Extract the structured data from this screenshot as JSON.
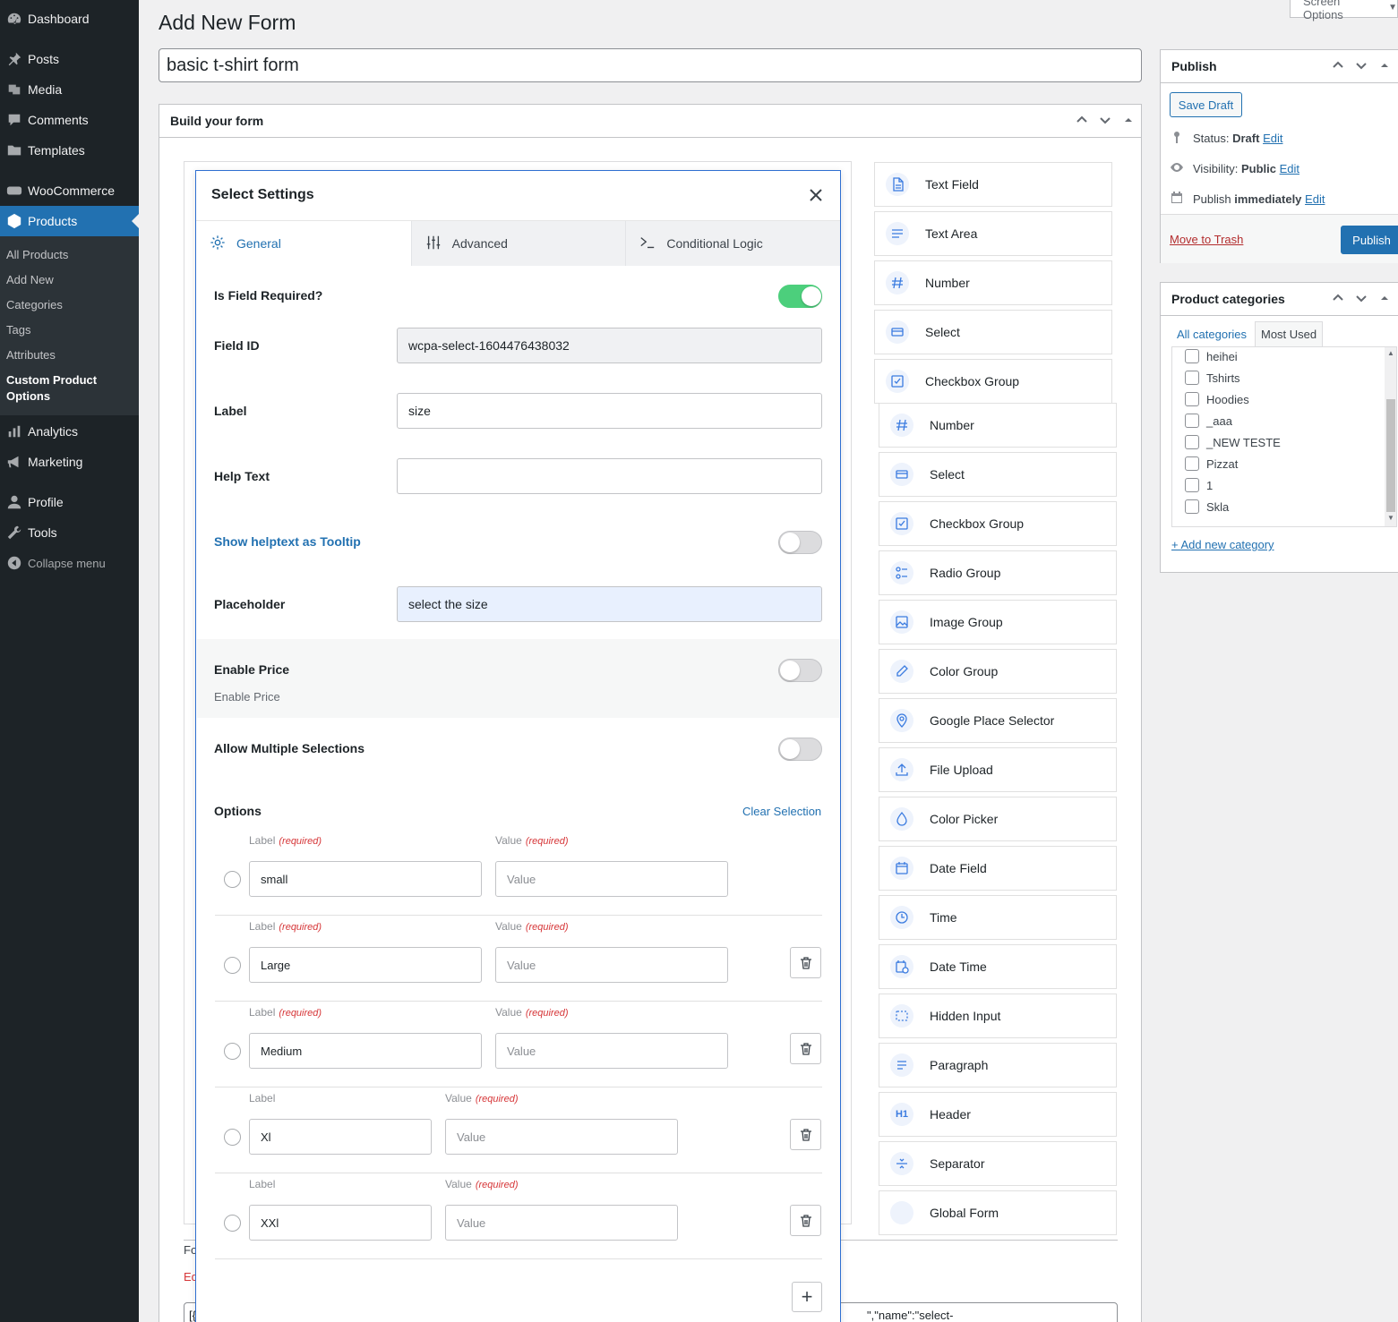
{
  "admin_menu": {
    "items": [
      {
        "label": "Dashboard",
        "icon": "dashboard-icon"
      },
      {
        "label": "Posts",
        "icon": "pin-icon"
      },
      {
        "label": "Media",
        "icon": "media-icon"
      },
      {
        "label": "Comments",
        "icon": "comment-icon"
      },
      {
        "label": "Templates",
        "icon": "folder-icon"
      },
      {
        "label": "WooCommerce",
        "icon": "woo-icon"
      },
      {
        "label": "Products",
        "icon": "box-icon"
      },
      {
        "label": "Analytics",
        "icon": "bar-chart-icon"
      },
      {
        "label": "Marketing",
        "icon": "megaphone-icon"
      },
      {
        "label": "Profile",
        "icon": "user-icon"
      },
      {
        "label": "Tools",
        "icon": "wrench-icon"
      }
    ],
    "submenu": [
      "All Products",
      "Add New",
      "Categories",
      "Tags",
      "Attributes",
      "Custom Product Options"
    ],
    "collapse_label": "Collapse menu"
  },
  "screen_options": "Screen Options",
  "page_title": "Add New Form",
  "form_title": "basic t-shirt form",
  "builder_box_title": "Build your form",
  "modal": {
    "title": "Select Settings",
    "tabs": [
      "General",
      "Advanced",
      "Conditional Logic"
    ],
    "is_required_label": "Is Field Required?",
    "is_required": true,
    "field_id_label": "Field ID",
    "field_id": "wcpa-select-1604476438032",
    "label_label": "Label",
    "label_value": "size",
    "help_label": "Help Text",
    "help_value": "",
    "tooltip_label": "Show helptext as Tooltip",
    "tooltip_on": false,
    "placeholder_label": "Placeholder",
    "placeholder_value": "select the size",
    "enable_price_label": "Enable Price",
    "enable_price_sub": "Enable Price",
    "enable_price_on": false,
    "multi_label": "Allow Multiple Selections",
    "multi_on": false,
    "options_label": "Options",
    "clear_selection": "Clear Selection",
    "col_label": "Label",
    "col_value": "Value",
    "required_tag": "(required)",
    "value_placeholder": "Value",
    "options": [
      {
        "label": "small",
        "label_required": true
      },
      {
        "label": "Large",
        "label_required": true
      },
      {
        "label": "Medium",
        "label_required": true
      },
      {
        "label": "Xl",
        "label_required": false
      },
      {
        "label": "XXl",
        "label_required": false
      }
    ],
    "add_option": "+"
  },
  "behind_fragments": {
    "fo": "Fo",
    "ed": "Ed",
    "json_left": "[{",
    "json_right": "\",\"name\":\"select-"
  },
  "palette": [
    {
      "label": "Text Field",
      "icon": "document-icon"
    },
    {
      "label": "Text Area",
      "icon": "lines-icon"
    },
    {
      "label": "Number",
      "icon": "hash-icon"
    },
    {
      "label": "Select",
      "icon": "select-icon"
    },
    {
      "label": "Checkbox Group",
      "icon": "checkbox-icon"
    },
    {
      "label": "Number",
      "icon": "hash-icon"
    },
    {
      "label": "Select",
      "icon": "select-icon"
    },
    {
      "label": "Checkbox Group",
      "icon": "checkbox-icon"
    },
    {
      "label": "Radio Group",
      "icon": "radio-list-icon"
    },
    {
      "label": "Image Group",
      "icon": "image-icon"
    },
    {
      "label": "Color Group",
      "icon": "eyedropper-icon"
    },
    {
      "label": "Google Place Selector",
      "icon": "map-pin-icon"
    },
    {
      "label": "File Upload",
      "icon": "upload-icon"
    },
    {
      "label": "Color Picker",
      "icon": "drop-icon"
    },
    {
      "label": "Date Field",
      "icon": "calendar-icon"
    },
    {
      "label": "Time",
      "icon": "clock-icon"
    },
    {
      "label": "Date Time",
      "icon": "calendar-clock-icon"
    },
    {
      "label": "Hidden Input",
      "icon": "dashed-box-icon"
    },
    {
      "label": "Paragraph",
      "icon": "paragraph-icon"
    },
    {
      "label": "Header",
      "icon": "h1-icon",
      "text": "H1"
    },
    {
      "label": "Separator",
      "icon": "separator-icon"
    },
    {
      "label": "Global Form",
      "icon": "blank-icon"
    }
  ],
  "publish": {
    "title": "Publish",
    "save_draft": "Save Draft",
    "status_label": "Status:",
    "status_value": "Draft",
    "visibility_label": "Visibility:",
    "visibility_value": "Public",
    "publish_label": "Publish",
    "publish_value": "immediately",
    "edit": "Edit",
    "trash": "Move to Trash",
    "publish_button": "Publish"
  },
  "categories": {
    "title": "Product categories",
    "tab_all": "All categories",
    "tab_most": "Most Used",
    "items": [
      "heihei",
      "Tshirts",
      "Hoodies",
      "_aaa",
      "_NEW TESTE",
      "Pizzat",
      "1",
      "Skla"
    ],
    "add_new": "+ Add new category"
  },
  "colors": {
    "accent": "#2271b1",
    "menu_bg": "#1d2327",
    "toggle_on": "#4ccf7c",
    "modal_border": "#2f6fd1",
    "required": "#d63638"
  }
}
